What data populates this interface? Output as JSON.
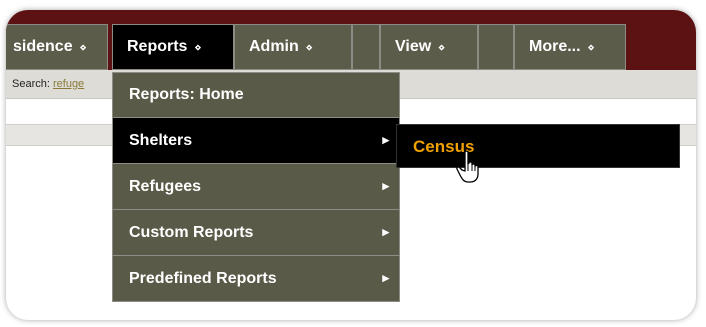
{
  "navbar": {
    "items": [
      {
        "label": "sidence",
        "arrow": "⋄"
      },
      {
        "label": "Reports",
        "arrow": "⋄"
      },
      {
        "label": "Admin",
        "arrow": "⋄"
      },
      {
        "label": ""
      },
      {
        "label": "View",
        "arrow": "⋄"
      },
      {
        "label": ""
      },
      {
        "label": "More...",
        "arrow": "⋄"
      }
    ]
  },
  "search": {
    "label": "Search:",
    "value": "refuge"
  },
  "reports_menu": {
    "items": [
      {
        "label": "Reports: Home"
      },
      {
        "label": "Shelters",
        "arrow": "▸"
      },
      {
        "label": "Refugees",
        "arrow": "▸"
      },
      {
        "label": "Custom Reports",
        "arrow": "▸"
      },
      {
        "label": "Predefined Reports",
        "arrow": "▸"
      }
    ]
  },
  "shelters_submenu": {
    "items": [
      {
        "label": "Census"
      }
    ]
  },
  "colors": {
    "navbar_bg": "#5c1212",
    "menu_bg": "#5a5a48",
    "active_bg": "#000000",
    "submenu_text": "#f0a000"
  },
  "icons": {
    "cursor": "hand-pointer-icon"
  }
}
